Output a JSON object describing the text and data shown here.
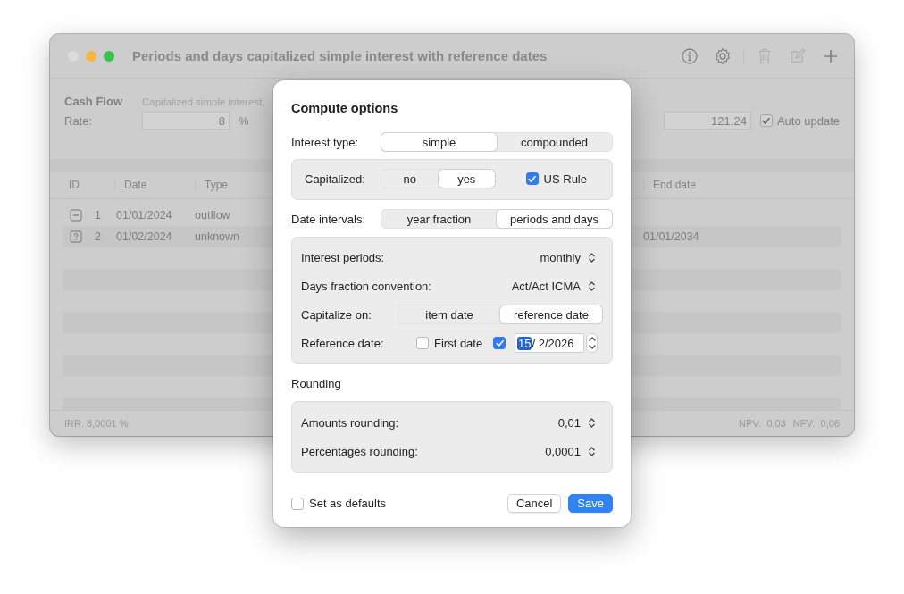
{
  "window": {
    "title": "Periods and days capitalized simple interest with reference dates",
    "toolbar": [
      {
        "kind": "info",
        "disabled": false
      },
      {
        "kind": "settings",
        "disabled": false
      },
      {
        "kind": "trash",
        "disabled": true
      },
      {
        "kind": "edit",
        "disabled": true
      },
      {
        "kind": "add",
        "disabled": false
      }
    ]
  },
  "header": {
    "title": "Cash Flow",
    "subtitle": "Capitalized simple interest,",
    "rate_label": "Rate:",
    "rate_value": "8",
    "rate_unit": "%",
    "amount_value": "121,24",
    "auto_update": {
      "label": "Auto update",
      "checked": true
    }
  },
  "table": {
    "columns": [
      "ID",
      "Date",
      "Type",
      "End date"
    ],
    "rows": [
      {
        "kind": "outflow",
        "id": "1",
        "date": "01/01/2024",
        "type": "outflow"
      },
      {
        "kind": "unknown",
        "id": "2",
        "date": "01/02/2024",
        "type": "unknown",
        "end_date": "01/01/2034"
      }
    ]
  },
  "status_bar": {
    "irr": "IRR: 8,0001 %",
    "metrics": [
      {
        "label": "NPV:",
        "value": "0,03"
      },
      {
        "label": "NFV:",
        "value": "0,06"
      }
    ]
  },
  "dialog": {
    "title": "Compute options",
    "interest_type": {
      "label": "Interest type:",
      "options": [
        {
          "label": "simple",
          "selected": true
        },
        {
          "label": "compounded",
          "selected": false
        }
      ]
    },
    "capitalized": {
      "label": "Capitalized:",
      "options": [
        {
          "label": "no",
          "selected": false
        },
        {
          "label": "yes",
          "selected": true
        }
      ],
      "us_rule": {
        "label": "US Rule",
        "checked": true
      }
    },
    "date_intervals": {
      "label": "Date intervals:",
      "options": [
        {
          "label": "year fraction",
          "selected": false
        },
        {
          "label": "periods and days",
          "selected": true
        }
      ]
    },
    "interest_periods": {
      "label": "Interest periods:",
      "value": "monthly"
    },
    "days_fraction": {
      "label": "Days fraction convention:",
      "value": "Act/Act ICMA"
    },
    "capitalize_on": {
      "label": "Capitalize on:",
      "options": [
        {
          "label": "item date",
          "selected": false
        },
        {
          "label": "reference date",
          "selected": true
        }
      ]
    },
    "reference_date": {
      "label": "Reference date:",
      "first_date": {
        "label": "First date",
        "checked": false
      },
      "custom": {
        "checked": true
      },
      "segments": [
        {
          "text": "15",
          "selected": true
        },
        {
          "text": "/",
          "selected": false
        },
        {
          "text": " 2/2026",
          "selected": false
        }
      ]
    },
    "rounding": {
      "title": "Rounding",
      "items": [
        {
          "label": "Amounts rounding:",
          "value": "0,01"
        },
        {
          "label": "Percentages rounding:",
          "value": "0,0001"
        }
      ]
    },
    "set_defaults": {
      "label": "Set as defaults",
      "checked": false
    },
    "buttons": [
      {
        "label": "Cancel",
        "kind": "secondary"
      },
      {
        "label": "Save",
        "kind": "primary"
      }
    ]
  }
}
